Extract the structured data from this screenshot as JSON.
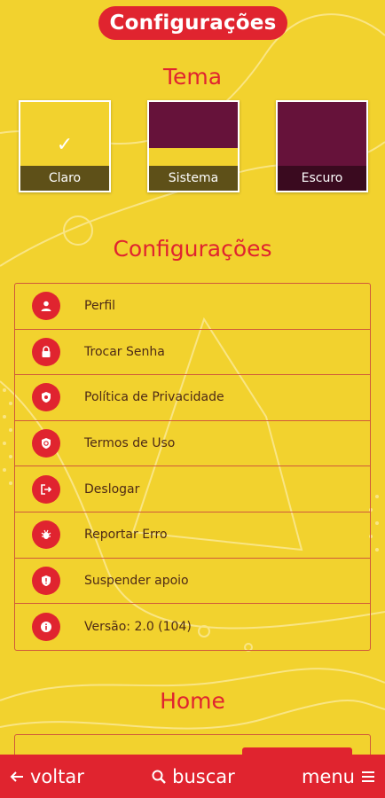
{
  "header": {
    "title": "Configurações"
  },
  "theme": {
    "title": "Tema",
    "options": [
      {
        "label": "Claro",
        "selected": true,
        "color": "#F2D22E"
      },
      {
        "label": "Sistema",
        "selected": false,
        "color": "#66123A"
      },
      {
        "label": "Escuro",
        "selected": false,
        "color": "#66123A"
      }
    ]
  },
  "settings": {
    "title": "Configurações",
    "items": [
      {
        "label": "Perfil",
        "icon": "user-icon"
      },
      {
        "label": "Trocar Senha",
        "icon": "lock-icon"
      },
      {
        "label": "Política de Privacidade",
        "icon": "shield-icon"
      },
      {
        "label": "Termos de Uso",
        "icon": "shield-at-icon"
      },
      {
        "label": "Deslogar",
        "icon": "logout-icon"
      },
      {
        "label": "Reportar Erro",
        "icon": "bug-icon"
      },
      {
        "label": "Suspender apoio",
        "icon": "shield-alert-icon"
      },
      {
        "label": "Versão: 2.0 (104)",
        "icon": "info-icon"
      }
    ]
  },
  "home": {
    "title": "Home"
  },
  "bottom_nav": {
    "back": "voltar",
    "search": "buscar",
    "menu": "menu"
  },
  "colors": {
    "background": "#F2D22E",
    "accent": "#E0242F",
    "dark_theme": "#66123A"
  }
}
